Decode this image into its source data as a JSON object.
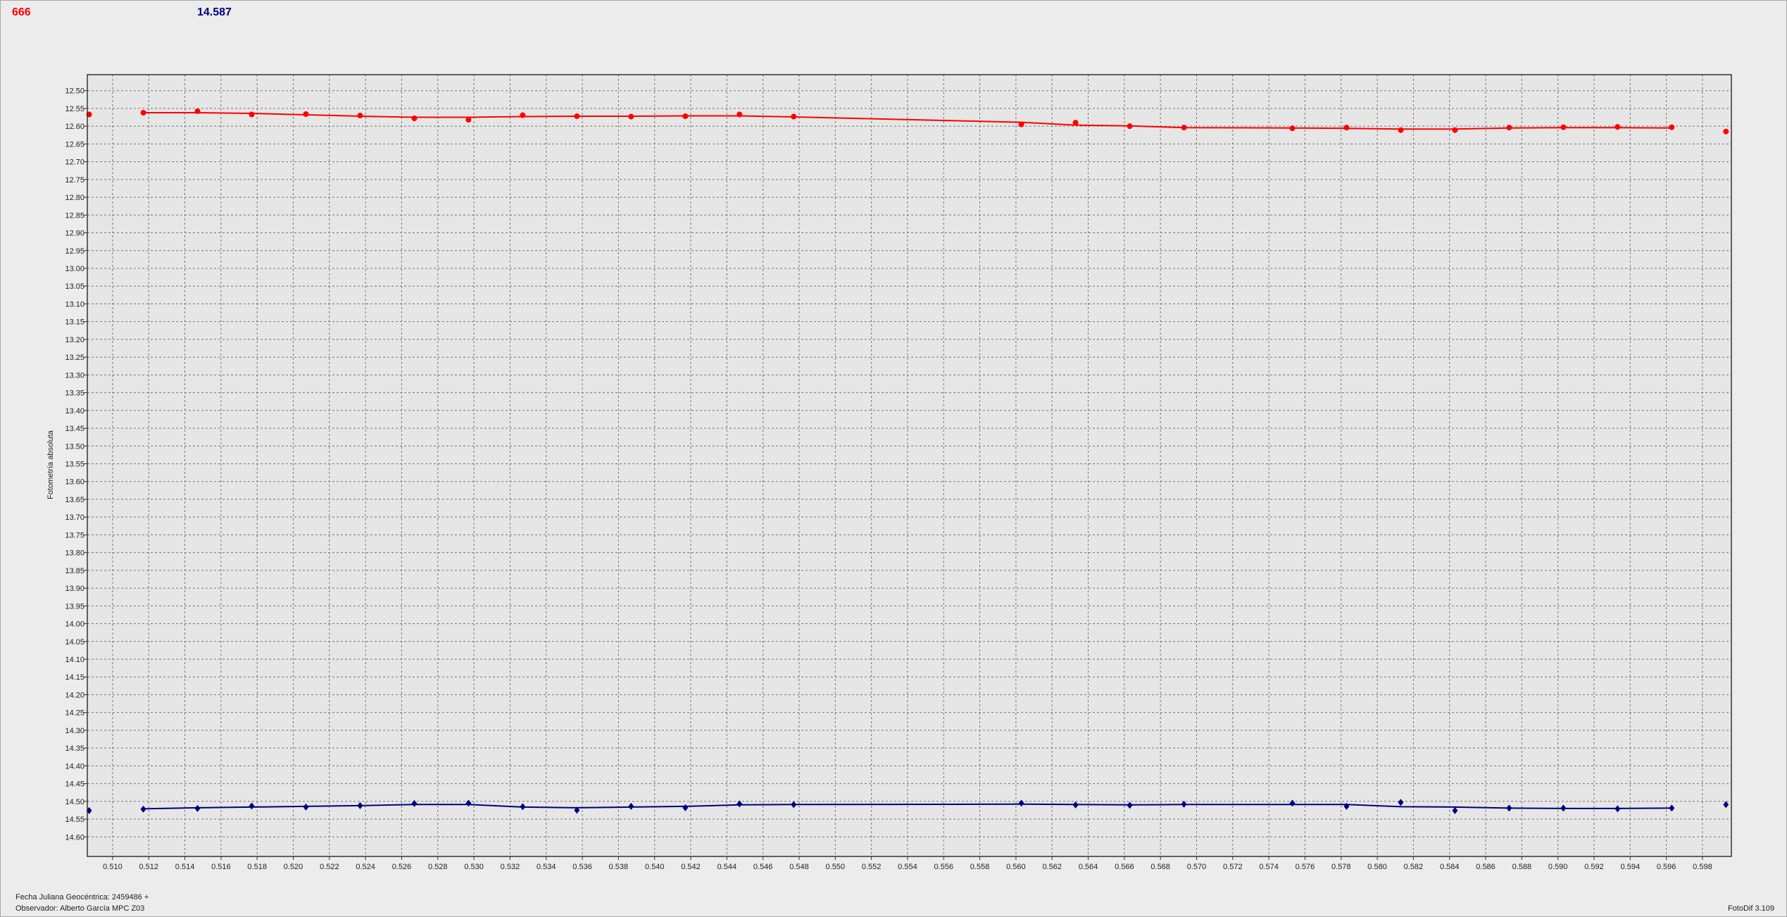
{
  "header": {
    "value_red": "666",
    "value_blue": "14.587"
  },
  "footer": {
    "date_label": "Fecha Juliana Geocéntrica: 2459486 +",
    "observer_label": "Observador: Alberto García MPC Z03",
    "version_label": "FotoDif 3.109"
  },
  "colors": {
    "red_series": "#ff0000",
    "blue_series": "#000080",
    "plot_bg": "#e6e6e6",
    "grid": "#777777"
  },
  "chart_data": {
    "type": "scatter",
    "ylabel": "Fotometría absoluta",
    "xlabel": "",
    "xlim": [
      0.5086,
      0.5996
    ],
    "ylim": [
      14.655,
      12.455
    ],
    "y_inverted": true,
    "grid": true,
    "x_ticks": [
      "0.510",
      "0.512",
      "0.514",
      "0.516",
      "0.518",
      "0.520",
      "0.522",
      "0.524",
      "0.526",
      "0.528",
      "0.530",
      "0.532",
      "0.534",
      "0.536",
      "0.538",
      "0.540",
      "0.542",
      "0.544",
      "0.546",
      "0.548",
      "0.550",
      "0.552",
      "0.554",
      "0.556",
      "0.558",
      "0.560",
      "0.562",
      "0.564",
      "0.566",
      "0.568",
      "0.570",
      "0.572",
      "0.574",
      "0.576",
      "0.578",
      "0.580",
      "0.582",
      "0.584",
      "0.586",
      "0.588",
      "0.590",
      "0.592",
      "0.594",
      "0.596",
      "0.598"
    ],
    "y_ticks": [
      "12.50",
      "12.55",
      "12.60",
      "12.65",
      "12.70",
      "12.75",
      "12.80",
      "12.85",
      "12.90",
      "12.95",
      "13.00",
      "13.05",
      "13.10",
      "13.15",
      "13.20",
      "13.25",
      "13.30",
      "13.35",
      "13.40",
      "13.45",
      "13.50",
      "13.55",
      "13.60",
      "13.65",
      "13.70",
      "13.75",
      "13.80",
      "13.85",
      "13.90",
      "13.95",
      "14.00",
      "14.05",
      "14.10",
      "14.15",
      "14.20",
      "14.25",
      "14.30",
      "14.35",
      "14.40",
      "14.45",
      "14.50",
      "14.55",
      "14.60"
    ],
    "series": [
      {
        "color": "#ff0000",
        "marker": "circle",
        "points": [
          {
            "x": 0.5087,
            "y": 12.567
          },
          {
            "x": 0.5117,
            "y": 12.562
          },
          {
            "x": 0.5147,
            "y": 12.558
          },
          {
            "x": 0.5177,
            "y": 12.567
          },
          {
            "x": 0.5207,
            "y": 12.566
          },
          {
            "x": 0.5237,
            "y": 12.57
          },
          {
            "x": 0.5267,
            "y": 12.578
          },
          {
            "x": 0.5297,
            "y": 12.582
          },
          {
            "x": 0.5327,
            "y": 12.569
          },
          {
            "x": 0.5357,
            "y": 12.572
          },
          {
            "x": 0.5387,
            "y": 12.573
          },
          {
            "x": 0.5417,
            "y": 12.572
          },
          {
            "x": 0.5447,
            "y": 12.567
          },
          {
            "x": 0.5477,
            "y": 12.573
          },
          {
            "x": 0.5603,
            "y": 12.595
          },
          {
            "x": 0.5633,
            "y": 12.59
          },
          {
            "x": 0.5663,
            "y": 12.6
          },
          {
            "x": 0.5693,
            "y": 12.604
          },
          {
            "x": 0.5753,
            "y": 12.606
          },
          {
            "x": 0.5783,
            "y": 12.604
          },
          {
            "x": 0.5813,
            "y": 12.611
          },
          {
            "x": 0.5843,
            "y": 12.611
          },
          {
            "x": 0.5873,
            "y": 12.604
          },
          {
            "x": 0.5903,
            "y": 12.603
          },
          {
            "x": 0.5933,
            "y": 12.602
          },
          {
            "x": 0.5963,
            "y": 12.603
          },
          {
            "x": 0.5993,
            "y": 12.615
          }
        ],
        "trend": [
          {
            "x": 0.5117,
            "y": 12.562
          },
          {
            "x": 0.5147,
            "y": 12.562
          },
          {
            "x": 0.5177,
            "y": 12.564
          },
          {
            "x": 0.5207,
            "y": 12.568
          },
          {
            "x": 0.5237,
            "y": 12.572
          },
          {
            "x": 0.5267,
            "y": 12.575
          },
          {
            "x": 0.5297,
            "y": 12.575
          },
          {
            "x": 0.5327,
            "y": 12.573
          },
          {
            "x": 0.5357,
            "y": 12.572
          },
          {
            "x": 0.5387,
            "y": 12.572
          },
          {
            "x": 0.5417,
            "y": 12.571
          },
          {
            "x": 0.5447,
            "y": 12.571
          },
          {
            "x": 0.5477,
            "y": 12.574
          },
          {
            "x": 0.5603,
            "y": 12.589
          },
          {
            "x": 0.5633,
            "y": 12.597
          },
          {
            "x": 0.5663,
            "y": 12.599
          },
          {
            "x": 0.5693,
            "y": 12.604
          },
          {
            "x": 0.5753,
            "y": 12.605
          },
          {
            "x": 0.5783,
            "y": 12.606
          },
          {
            "x": 0.5813,
            "y": 12.608
          },
          {
            "x": 0.5843,
            "y": 12.608
          },
          {
            "x": 0.5873,
            "y": 12.605
          },
          {
            "x": 0.5903,
            "y": 12.604
          },
          {
            "x": 0.5933,
            "y": 12.604
          },
          {
            "x": 0.5963,
            "y": 12.605
          }
        ]
      },
      {
        "color": "#000080",
        "marker": "diamond",
        "points": [
          {
            "x": 0.5087,
            "y": 14.526
          },
          {
            "x": 0.5117,
            "y": 14.522
          },
          {
            "x": 0.5147,
            "y": 14.52
          },
          {
            "x": 0.5177,
            "y": 14.513
          },
          {
            "x": 0.5207,
            "y": 14.516
          },
          {
            "x": 0.5237,
            "y": 14.512
          },
          {
            "x": 0.5267,
            "y": 14.506
          },
          {
            "x": 0.5297,
            "y": 14.505
          },
          {
            "x": 0.5327,
            "y": 14.515
          },
          {
            "x": 0.5357,
            "y": 14.525
          },
          {
            "x": 0.5387,
            "y": 14.514
          },
          {
            "x": 0.5417,
            "y": 14.518
          },
          {
            "x": 0.5447,
            "y": 14.507
          },
          {
            "x": 0.5477,
            "y": 14.509
          },
          {
            "x": 0.5603,
            "y": 14.505
          },
          {
            "x": 0.5633,
            "y": 14.51
          },
          {
            "x": 0.5663,
            "y": 14.511
          },
          {
            "x": 0.5693,
            "y": 14.508
          },
          {
            "x": 0.5753,
            "y": 14.505
          },
          {
            "x": 0.5783,
            "y": 14.514
          },
          {
            "x": 0.5813,
            "y": 14.503
          },
          {
            "x": 0.5843,
            "y": 14.526
          },
          {
            "x": 0.5873,
            "y": 14.519
          },
          {
            "x": 0.5903,
            "y": 14.519
          },
          {
            "x": 0.5933,
            "y": 14.521
          },
          {
            "x": 0.5963,
            "y": 14.519
          },
          {
            "x": 0.5993,
            "y": 14.509
          }
        ],
        "trend": [
          {
            "x": 0.5117,
            "y": 14.521
          },
          {
            "x": 0.5147,
            "y": 14.518
          },
          {
            "x": 0.5177,
            "y": 14.516
          },
          {
            "x": 0.5207,
            "y": 14.514
          },
          {
            "x": 0.5237,
            "y": 14.512
          },
          {
            "x": 0.5267,
            "y": 14.509
          },
          {
            "x": 0.5297,
            "y": 14.509
          },
          {
            "x": 0.5327,
            "y": 14.516
          },
          {
            "x": 0.5357,
            "y": 14.518
          },
          {
            "x": 0.5387,
            "y": 14.516
          },
          {
            "x": 0.5417,
            "y": 14.514
          },
          {
            "x": 0.5447,
            "y": 14.51
          },
          {
            "x": 0.5477,
            "y": 14.509
          },
          {
            "x": 0.5603,
            "y": 14.508
          },
          {
            "x": 0.5633,
            "y": 14.509
          },
          {
            "x": 0.5663,
            "y": 14.51
          },
          {
            "x": 0.5693,
            "y": 14.509
          },
          {
            "x": 0.5753,
            "y": 14.509
          },
          {
            "x": 0.5783,
            "y": 14.509
          },
          {
            "x": 0.5813,
            "y": 14.515
          },
          {
            "x": 0.5843,
            "y": 14.516
          },
          {
            "x": 0.5873,
            "y": 14.519
          },
          {
            "x": 0.5903,
            "y": 14.52
          },
          {
            "x": 0.5933,
            "y": 14.52
          },
          {
            "x": 0.5963,
            "y": 14.519
          }
        ]
      }
    ]
  }
}
